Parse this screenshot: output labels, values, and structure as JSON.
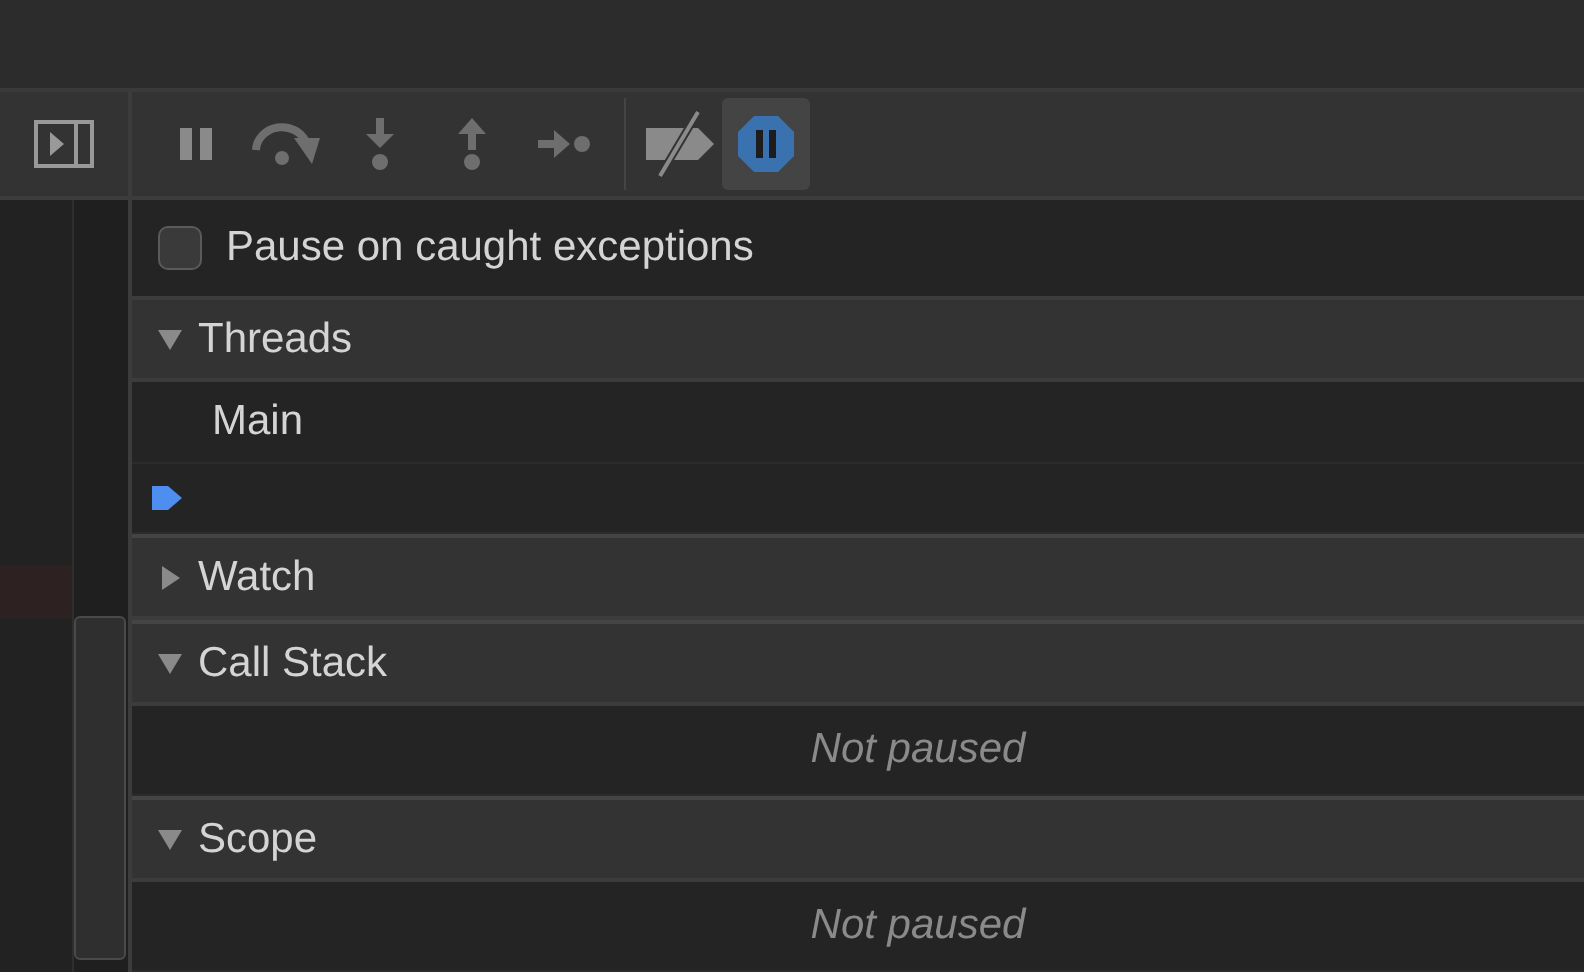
{
  "toolbar": {
    "buttons": [
      {
        "kind": "sidebar",
        "selected": false
      },
      {
        "kind": "pause",
        "selected": false
      },
      {
        "kind": "step_over",
        "selected": false
      },
      {
        "kind": "step_into",
        "selected": false
      },
      {
        "kind": "step_out",
        "selected": false
      },
      {
        "kind": "step",
        "selected": false
      },
      {
        "kind": "deactivate_breakpoints",
        "selected": false
      },
      {
        "kind": "pause_on_exceptions",
        "selected": true
      }
    ]
  },
  "pause_on_caught": {
    "label": "Pause on caught exceptions",
    "checked": false
  },
  "sections": [
    {
      "title": "Threads",
      "expanded": true,
      "rows": [
        {
          "kind": "thread",
          "text": "Main"
        },
        {
          "kind": "current"
        }
      ]
    },
    {
      "title": "Watch",
      "expanded": false
    },
    {
      "title": "Call Stack",
      "expanded": true,
      "rows": [
        {
          "kind": "empty",
          "text": "Not paused"
        }
      ]
    },
    {
      "title": "Scope",
      "expanded": true,
      "rows": [
        {
          "kind": "empty",
          "text": "Not paused"
        }
      ]
    }
  ]
}
